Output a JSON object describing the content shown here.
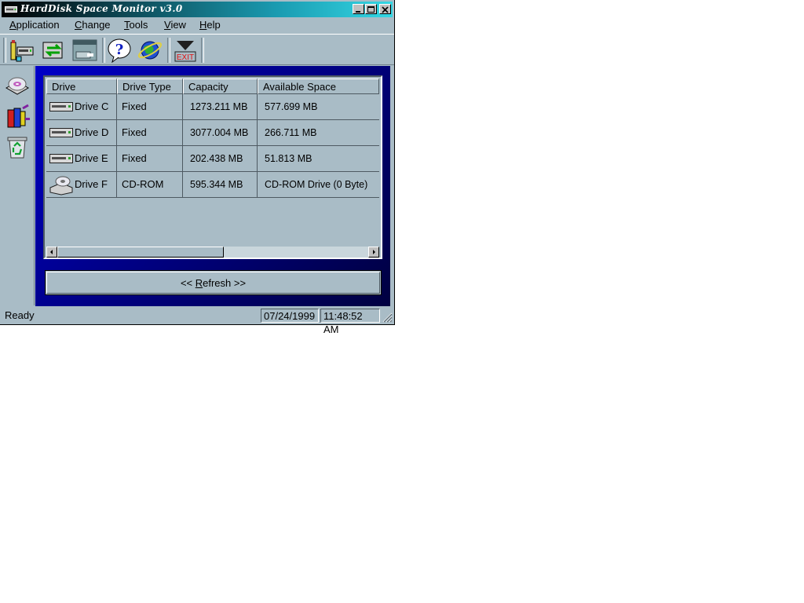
{
  "window": {
    "title": "HardDisk Space Monitor v3.0"
  },
  "title_buttons": {
    "minimize": "_",
    "maximize": "□",
    "close": "×"
  },
  "menu": [
    {
      "label": "Application",
      "underline": "A",
      "rest": "pplication"
    },
    {
      "label": "Change",
      "underline": "C",
      "rest": "hange"
    },
    {
      "label": "Tools",
      "underline": "T",
      "rest": "ools"
    },
    {
      "label": "View",
      "underline": "V",
      "rest": "iew"
    },
    {
      "label": "Help",
      "underline": "H",
      "rest": "elp"
    }
  ],
  "toolbar": {
    "icons": [
      "drive-info-icon",
      "refresh-drives-icon",
      "window-view-icon",
      "help-icon",
      "web-globe-icon",
      "exit-icon"
    ],
    "exit_label": "EXIT"
  },
  "sidebar": {
    "icons": [
      "cd-drive-icon",
      "programs-icon",
      "recycle-bin-icon"
    ]
  },
  "table": {
    "columns": [
      "Drive",
      "Drive Type",
      "Capacity",
      "Available Space"
    ],
    "rows": [
      {
        "drive": "Drive C",
        "type": "Fixed",
        "capacity": "1273.211 MB",
        "available": "577.699 MB",
        "icon": "hard-drive-icon"
      },
      {
        "drive": "Drive D",
        "type": "Fixed",
        "capacity": "3077.004 MB",
        "available": "266.711 MB",
        "icon": "hard-drive-icon"
      },
      {
        "drive": "Drive E",
        "type": "Fixed",
        "capacity": "202.438 MB",
        "available": "51.813 MB",
        "icon": "hard-drive-icon"
      },
      {
        "drive": "Drive F",
        "type": "CD-ROM",
        "capacity": "595.344 MB",
        "available": "CD-ROM Drive (0 Byte)",
        "icon": "cdrom-drive-icon"
      }
    ]
  },
  "refresh_button": {
    "prefix": "<< ",
    "underline": "R",
    "rest": "efresh",
    "suffix": " >>"
  },
  "status": {
    "text": "Ready",
    "date": "07/24/1999",
    "time": "11:48:52 AM"
  },
  "colors": {
    "window_bg": "#a9bcc6",
    "panel_bg": "#0000c8",
    "title_start": "#000000",
    "title_end": "#34d7e4"
  }
}
